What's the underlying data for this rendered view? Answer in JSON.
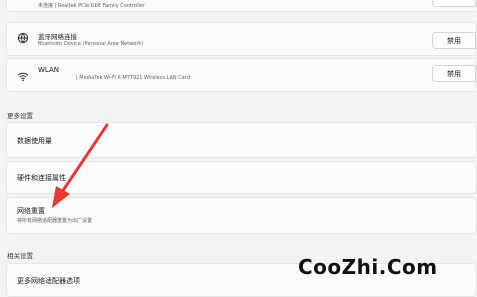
{
  "adapters": [
    {
      "title": "",
      "subtitle": "未连接 | Realtek PCIe GbE Family Controller",
      "button": "",
      "icon": "ethernet-icon"
    },
    {
      "title": "蓝牙网络连接",
      "subtitle": "Bluetooth Device (Personal Area Network)",
      "button": "禁用",
      "icon": "globe-icon"
    },
    {
      "title": "WLAN",
      "subtitle": "| MediaTek Wi-Fi 6 MT7921 Wireless LAN Card",
      "button": "禁用",
      "icon": "wifi-icon"
    }
  ],
  "more_settings": {
    "header": "更多设置",
    "items": [
      {
        "title": "数据使用量",
        "subtitle": ""
      },
      {
        "title": "硬件和连接属性",
        "subtitle": ""
      },
      {
        "title": "网络重置",
        "subtitle": "将所有网络适配器重置为出厂设置"
      }
    ]
  },
  "related_settings": {
    "header": "相关设置",
    "items": [
      {
        "title": "更多网络适配器选项"
      }
    ]
  },
  "watermark": "CooZhi.Com",
  "colors": {
    "arrow": "#e53935",
    "background": "#f3f3f3",
    "card": "#fbfbfb"
  }
}
